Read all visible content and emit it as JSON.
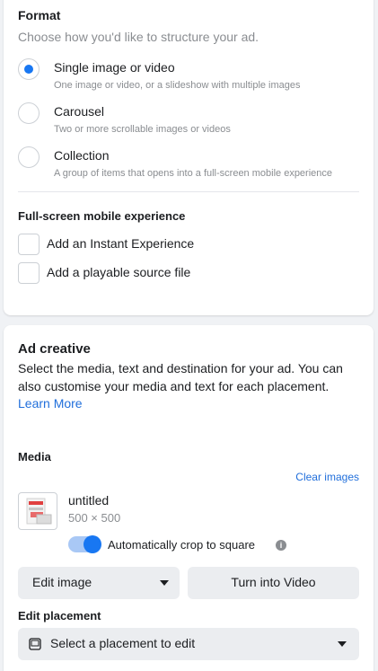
{
  "format": {
    "title": "Format",
    "subtitle": "Choose how you'd like to structure your ad.",
    "options": [
      {
        "label": "Single image or video",
        "description": "One image or video, or a slideshow with multiple images",
        "selected": true
      },
      {
        "label": "Carousel",
        "description": "Two or more scrollable images or videos",
        "selected": false
      },
      {
        "label": "Collection",
        "description": "A group of items that opens into a full-screen mobile experience",
        "selected": false
      }
    ]
  },
  "fullscreen": {
    "title": "Full-screen mobile experience",
    "options": [
      {
        "label": "Add an Instant Experience",
        "checked": false
      },
      {
        "label": "Add a playable source file",
        "checked": false
      }
    ]
  },
  "creative": {
    "title": "Ad creative",
    "description": "Select the media, text and destination for your ad. You can also customise your media and text for each placement.",
    "learn_more": "Learn More",
    "media_title": "Media",
    "clear_images": "Clear images",
    "file_name": "untitled",
    "file_dims": "500 × 500",
    "crop_label": "Automatically crop to square",
    "crop_enabled": true,
    "info_glyph": "i",
    "edit_image": "Edit image",
    "turn_into_video": "Turn into Video",
    "edit_placement_title": "Edit placement",
    "placement_placeholder": "Select a placement to edit"
  },
  "colors": {
    "accent": "#1877f2",
    "link": "#216fdb",
    "muted": "#8a8d91"
  }
}
